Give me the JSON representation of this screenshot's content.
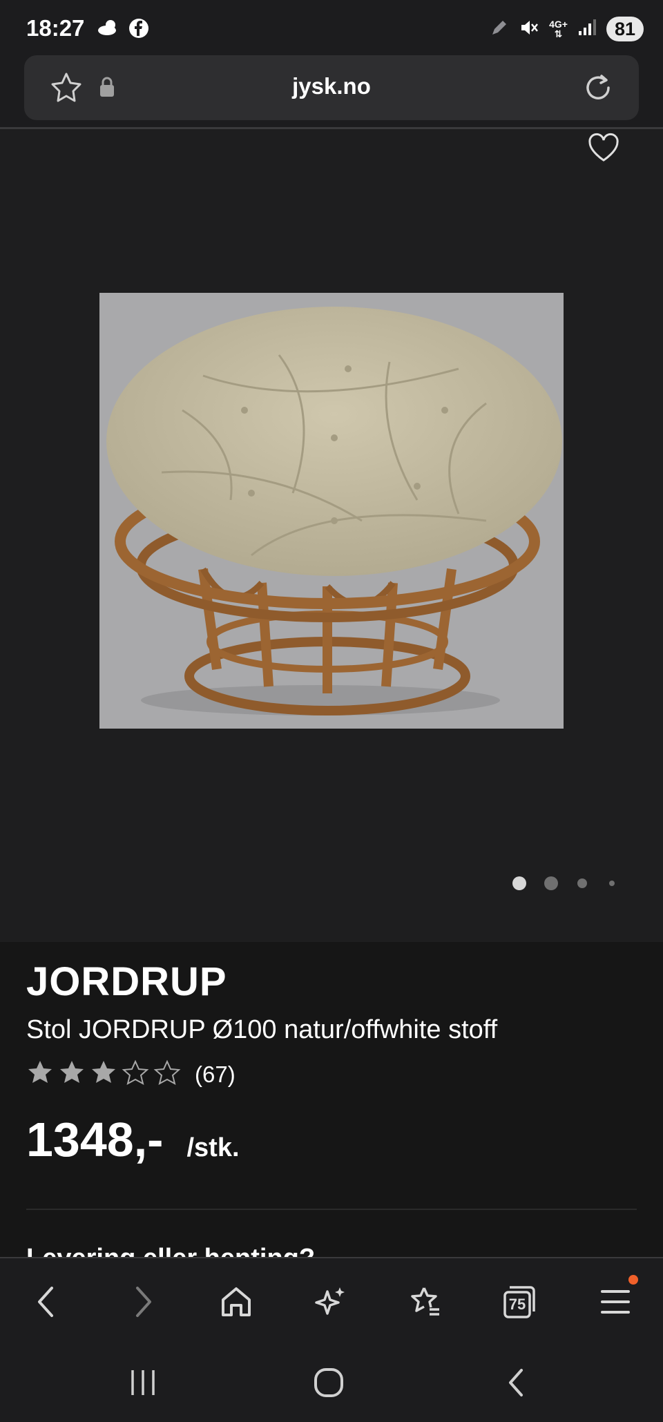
{
  "status_bar": {
    "time": "18:27",
    "battery": "81",
    "network": "4G+"
  },
  "browser": {
    "url": "jysk.no",
    "tabs_count": "75"
  },
  "gallery": {
    "image_alt": "Papasan chair",
    "active_dot": 0
  },
  "product": {
    "brand": "JORDRUP",
    "subtitle": "Stol JORDRUP Ø100 natur/offwhite stoff",
    "rating": 3,
    "rating_max": 5,
    "rating_count": "(67)",
    "price": "1348,-",
    "price_unit": "/stk.",
    "next_section_cut": "Levering eller henting?"
  },
  "colors": {
    "background": "#1e1e1f",
    "info_background": "#161616",
    "notification": "#f0602a"
  }
}
